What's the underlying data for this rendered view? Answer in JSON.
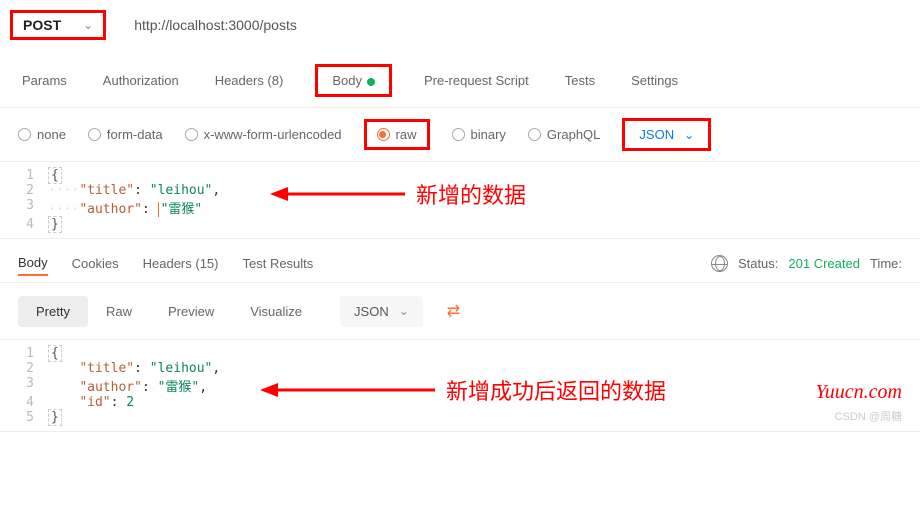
{
  "request": {
    "method": "POST",
    "url": "http://localhost:3000/posts"
  },
  "tabs": {
    "params": "Params",
    "auth": "Authorization",
    "headers": "Headers (8)",
    "body": "Body",
    "prereq": "Pre-request Script",
    "tests": "Tests",
    "settings": "Settings"
  },
  "body_types": {
    "none": "none",
    "form_data": "form-data",
    "urlencoded": "x-www-form-urlencoded",
    "raw": "raw",
    "binary": "binary",
    "graphql": "GraphQL"
  },
  "format": "JSON",
  "request_body_lines": {
    "l1": "{",
    "l2": {
      "key": "\"title\"",
      "sep": ": ",
      "val": "\"leihou\"",
      "trail": ","
    },
    "l3": {
      "key": "\"author\"",
      "sep": ": ",
      "val": "\"雷猴\""
    },
    "l4": "}"
  },
  "annotation1": "新增的数据",
  "response": {
    "tabs": {
      "body": "Body",
      "cookies": "Cookies",
      "headers": "Headers (15)",
      "test_results": "Test Results"
    },
    "status_label": "Status:",
    "status_value": "201 Created",
    "time_label": "Time:"
  },
  "view": {
    "pretty": "Pretty",
    "raw": "Raw",
    "preview": "Preview",
    "visualize": "Visualize",
    "format": "JSON"
  },
  "response_body_lines": {
    "l1": "{",
    "l2": {
      "key": "\"title\"",
      "sep": ": ",
      "val": "\"leihou\"",
      "trail": ","
    },
    "l3": {
      "key": "\"author\"",
      "sep": ": ",
      "val": "\"雷猴\"",
      "trail": ","
    },
    "l4": {
      "key": "\"id\"",
      "sep": ": ",
      "val": "2"
    },
    "l5": "}"
  },
  "annotation2": "新增成功后返回的数据",
  "watermark1": "Yuucn.com",
  "watermark2": "CSDN @周糖"
}
